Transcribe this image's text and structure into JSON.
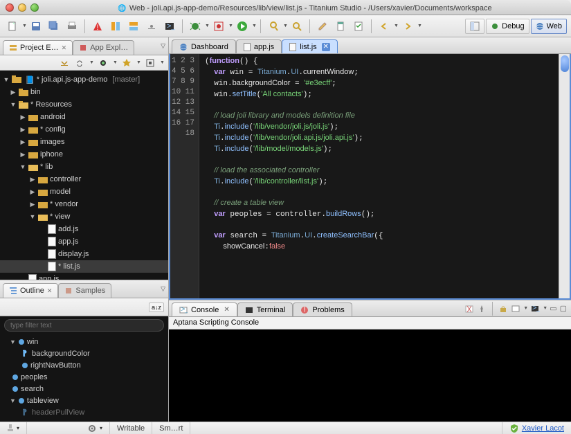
{
  "title": "Web - joli.api.js-app-demo/Resources/lib/view/list.js - Titanium Studio - /Users/xavier/Documents/workspace",
  "perspectives": {
    "debug": "Debug",
    "web": "Web"
  },
  "left_views": {
    "project_explorer": "Project E…",
    "app_explorer": "App Expl…"
  },
  "project_tree": {
    "root": {
      "name": "* joli.api.js-app-demo",
      "branch": "[master]"
    },
    "children": [
      {
        "name": "bin",
        "type": "folder",
        "open": false
      },
      {
        "name": "* Resources",
        "type": "folder",
        "open": true,
        "star": true,
        "children": [
          {
            "name": "android",
            "type": "folder"
          },
          {
            "name": "* config",
            "type": "folder",
            "star": true
          },
          {
            "name": "images",
            "type": "folder"
          },
          {
            "name": "iphone",
            "type": "folder"
          },
          {
            "name": "* lib",
            "type": "folder",
            "open": true,
            "star": true,
            "children": [
              {
                "name": "controller",
                "type": "folder"
              },
              {
                "name": "model",
                "type": "folder"
              },
              {
                "name": "* vendor",
                "type": "folder",
                "star": true
              },
              {
                "name": "* view",
                "type": "folder",
                "open": true,
                "star": true,
                "children": [
                  {
                    "name": "add.js",
                    "type": "file"
                  },
                  {
                    "name": "app.js",
                    "type": "file"
                  },
                  {
                    "name": "display.js",
                    "type": "file"
                  },
                  {
                    "name": "* list.js",
                    "type": "file",
                    "selected": true
                  }
                ]
              }
            ]
          },
          {
            "name": "app.js",
            "type": "file"
          }
        ]
      }
    ]
  },
  "outline_view": {
    "tabs": {
      "outline": "Outline",
      "samples": "Samples"
    },
    "filter_placeholder": "type filter text",
    "sort_label": "a↓z",
    "items": [
      {
        "name": "win",
        "kind": "var",
        "children": [
          {
            "name": "backgroundColor",
            "kind": "prop"
          },
          {
            "name": "rightNavButton",
            "kind": "method"
          }
        ]
      },
      {
        "name": "peoples",
        "kind": "var"
      },
      {
        "name": "search",
        "kind": "var"
      },
      {
        "name": "tableview",
        "kind": "var",
        "children": [
          {
            "name": "headerPullView",
            "kind": "prop",
            "cut": true
          }
        ]
      }
    ]
  },
  "editor": {
    "tabs": [
      {
        "label": "Dashboard",
        "icon": "globe"
      },
      {
        "label": "app.js",
        "icon": "js"
      },
      {
        "label": "list.js",
        "icon": "js",
        "active": true
      }
    ],
    "lines": [
      {
        "n": 1,
        "tokens": [
          [
            "",
            "("
          ],
          [
            "kw",
            "function"
          ],
          [
            "",
            "() {"
          ]
        ]
      },
      {
        "n": 2,
        "tokens": [
          [
            "",
            "  "
          ],
          [
            "kw",
            "var"
          ],
          [
            "",
            " win = "
          ],
          [
            "id",
            "Titanium"
          ],
          [
            "",
            "."
          ],
          [
            "id",
            "UI"
          ],
          [
            "",
            "."
          ],
          [
            "prop",
            "currentWindow"
          ],
          [
            "",
            ";"
          ]
        ]
      },
      {
        "n": 3,
        "tokens": [
          [
            "",
            "  win."
          ],
          [
            "prop",
            "backgroundColor"
          ],
          [
            "",
            " = "
          ],
          [
            "str",
            "'#e3ecff'"
          ],
          [
            "",
            ";"
          ]
        ]
      },
      {
        "n": 4,
        "tokens": [
          [
            "",
            "  win."
          ],
          [
            "fn",
            "setTitle"
          ],
          [
            "",
            "("
          ],
          [
            "str",
            "'All contacts'"
          ],
          [
            "",
            ");"
          ]
        ]
      },
      {
        "n": 5,
        "tokens": [
          [
            "",
            ""
          ]
        ]
      },
      {
        "n": 6,
        "tokens": [
          [
            "",
            "  "
          ],
          [
            "com",
            "// load joli library and models definition file"
          ]
        ]
      },
      {
        "n": 7,
        "tokens": [
          [
            "",
            "  "
          ],
          [
            "id",
            "Ti"
          ],
          [
            "",
            "."
          ],
          [
            "fn",
            "include"
          ],
          [
            "",
            "("
          ],
          [
            "str",
            "'/lib/vendor/joli.js/joli.js'"
          ],
          [
            "",
            ");"
          ]
        ]
      },
      {
        "n": 8,
        "tokens": [
          [
            "",
            "  "
          ],
          [
            "id",
            "Ti"
          ],
          [
            "",
            "."
          ],
          [
            "fn",
            "include"
          ],
          [
            "",
            "("
          ],
          [
            "str",
            "'/lib/vendor/joli.api.js/joli.api.js'"
          ],
          [
            "",
            ");"
          ]
        ]
      },
      {
        "n": 9,
        "tokens": [
          [
            "",
            "  "
          ],
          [
            "id",
            "Ti"
          ],
          [
            "",
            "."
          ],
          [
            "fn",
            "include"
          ],
          [
            "",
            "("
          ],
          [
            "str",
            "'/lib/model/models.js'"
          ],
          [
            "",
            ");"
          ]
        ]
      },
      {
        "n": 10,
        "tokens": [
          [
            "",
            ""
          ]
        ]
      },
      {
        "n": 11,
        "tokens": [
          [
            "",
            "  "
          ],
          [
            "com",
            "// load the associated controller"
          ]
        ]
      },
      {
        "n": 12,
        "tokens": [
          [
            "",
            "  "
          ],
          [
            "id",
            "Ti"
          ],
          [
            "",
            "."
          ],
          [
            "fn",
            "include"
          ],
          [
            "",
            "("
          ],
          [
            "str",
            "'/lib/controller/list.js'"
          ],
          [
            "",
            ");"
          ]
        ]
      },
      {
        "n": 13,
        "tokens": [
          [
            "",
            ""
          ]
        ]
      },
      {
        "n": 14,
        "tokens": [
          [
            "",
            "  "
          ],
          [
            "com",
            "// create a table view"
          ]
        ]
      },
      {
        "n": 15,
        "tokens": [
          [
            "",
            "  "
          ],
          [
            "kw",
            "var"
          ],
          [
            "",
            " peoples = controller."
          ],
          [
            "fn",
            "buildRows"
          ],
          [
            "",
            "();"
          ]
        ]
      },
      {
        "n": 16,
        "tokens": [
          [
            "",
            ""
          ]
        ]
      },
      {
        "n": 17,
        "tokens": [
          [
            "",
            "  "
          ],
          [
            "kw",
            "var"
          ],
          [
            "",
            " search = "
          ],
          [
            "id",
            "Titanium"
          ],
          [
            "",
            "."
          ],
          [
            "id",
            "UI"
          ],
          [
            "",
            "."
          ],
          [
            "fn",
            "createSearchBar"
          ],
          [
            "",
            "({"
          ]
        ]
      },
      {
        "n": 18,
        "tokens": [
          [
            "",
            "    "
          ],
          [
            "prop",
            "showCancel"
          ],
          [
            "",
            ":"
          ],
          [
            "bool",
            "false"
          ]
        ]
      }
    ]
  },
  "console": {
    "tabs": {
      "console": "Console",
      "terminal": "Terminal",
      "problems": "Problems"
    },
    "title": "Aptana Scripting Console"
  },
  "status": {
    "writable": "Writable",
    "insert": "Sm…rt",
    "user": "Xavier Lacot"
  }
}
